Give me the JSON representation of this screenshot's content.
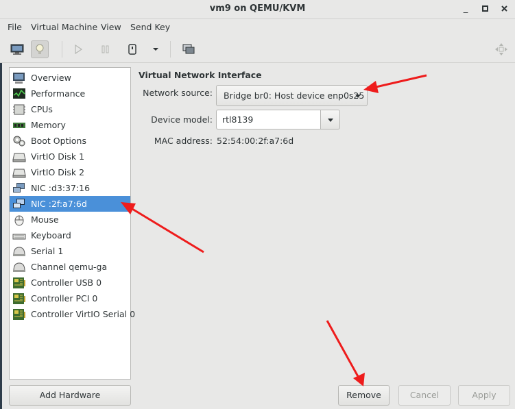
{
  "window": {
    "title": "vm9 on QEMU/KVM",
    "minimize": "_",
    "maximize": "□",
    "close": "✕"
  },
  "menu": [
    "File",
    "Virtual Machine",
    "View",
    "Send Key"
  ],
  "sidebar": {
    "items": [
      {
        "label": "Overview",
        "icon": "monitor-icon"
      },
      {
        "label": "Performance",
        "icon": "performance-chart-icon"
      },
      {
        "label": "CPUs",
        "icon": "cpu-icon"
      },
      {
        "label": "Memory",
        "icon": "memory-icon"
      },
      {
        "label": "Boot Options",
        "icon": "gears-icon"
      },
      {
        "label": "VirtIO Disk 1",
        "icon": "disk-icon"
      },
      {
        "label": "VirtIO Disk 2",
        "icon": "disk-icon"
      },
      {
        "label": "NIC :d3:37:16",
        "icon": "network-icon"
      },
      {
        "label": "NIC :2f:a7:6d",
        "icon": "network-icon"
      },
      {
        "label": "Mouse",
        "icon": "mouse-icon"
      },
      {
        "label": "Keyboard",
        "icon": "keyboard-icon"
      },
      {
        "label": "Serial 1",
        "icon": "serial-icon"
      },
      {
        "label": "Channel qemu-ga",
        "icon": "channel-icon"
      },
      {
        "label": "Controller USB 0",
        "icon": "controller-icon"
      },
      {
        "label": "Controller PCI 0",
        "icon": "controller-icon"
      },
      {
        "label": "Controller VirtIO Serial 0",
        "icon": "controller-icon"
      }
    ],
    "selected_index": 8,
    "add_hardware": "Add Hardware"
  },
  "details": {
    "section_title": "Virtual Network Interface",
    "network_source_label": "Network source:",
    "network_source_value": "Bridge br0: Host device enp0s25",
    "device_model_label": "Device model:",
    "device_model_value": "rtl8139",
    "mac_label": "MAC address:",
    "mac_value": "52:54:00:2f:a7:6d"
  },
  "buttons": {
    "remove": "Remove",
    "cancel": "Cancel",
    "apply": "Apply"
  },
  "colors": {
    "selection": "#4a90d9",
    "annotation_arrow": "#ee1c1c"
  }
}
